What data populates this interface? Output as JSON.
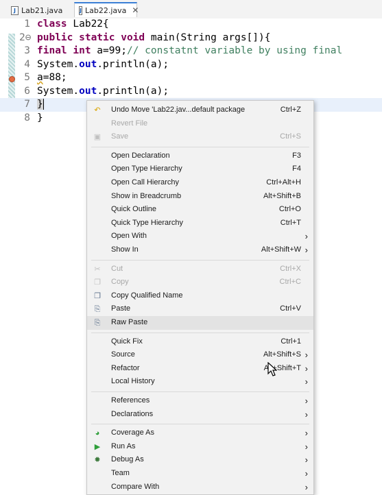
{
  "tabs": [
    {
      "label": "Lab21.java",
      "active": false
    },
    {
      "label": "Lab22.java",
      "active": true
    }
  ],
  "editor": {
    "lines": [
      {
        "num": "1",
        "parts": [
          [
            "kw",
            "class"
          ],
          [
            "t",
            " Lab22{"
          ]
        ]
      },
      {
        "num": "2⊖",
        "parts": [
          [
            "kw",
            "public static void"
          ],
          [
            "t",
            " main(String args[]){"
          ]
        ]
      },
      {
        "num": "3",
        "parts": [
          [
            "kw",
            "final int"
          ],
          [
            "t",
            " a=99;"
          ],
          [
            "cmt",
            "// constatnt variable by using final"
          ]
        ]
      },
      {
        "num": "4",
        "parts": [
          [
            "t",
            "System."
          ],
          [
            "field",
            "out"
          ],
          [
            "t",
            ".println(a);"
          ]
        ]
      },
      {
        "num": "5",
        "parts": [
          [
            "sq",
            "a"
          ],
          [
            "t",
            "=88;"
          ]
        ]
      },
      {
        "num": "6",
        "parts": [
          [
            "t",
            "System."
          ],
          [
            "field",
            "out"
          ],
          [
            "t",
            ".println(a);"
          ]
        ]
      },
      {
        "num": "7",
        "parts": [
          [
            "hl",
            "}"
          ],
          [
            "caret",
            ""
          ]
        ]
      },
      {
        "num": "8",
        "parts": [
          [
            "t",
            "}"
          ]
        ]
      }
    ]
  },
  "menu": {
    "items": [
      {
        "label": "Undo Move 'Lab22.jav...default package",
        "shortcut": "Ctrl+Z",
        "icon": "undo-icon",
        "glyph": "↶",
        "enabled": true
      },
      {
        "label": "Revert File",
        "shortcut": "",
        "enabled": false
      },
      {
        "label": "Save",
        "shortcut": "Ctrl+S",
        "icon": "save-icon",
        "glyph": "▣",
        "enabled": false
      },
      {
        "sep": true
      },
      {
        "label": "Open Declaration",
        "shortcut": "F3",
        "enabled": true
      },
      {
        "label": "Open Type Hierarchy",
        "shortcut": "F4",
        "enabled": true
      },
      {
        "label": "Open Call Hierarchy",
        "shortcut": "Ctrl+Alt+H",
        "enabled": true
      },
      {
        "label": "Show in Breadcrumb",
        "shortcut": "Alt+Shift+B",
        "enabled": true
      },
      {
        "label": "Quick Outline",
        "shortcut": "Ctrl+O",
        "enabled": true
      },
      {
        "label": "Quick Type Hierarchy",
        "shortcut": "Ctrl+T",
        "enabled": true
      },
      {
        "label": "Open With",
        "shortcut": "",
        "submenu": true,
        "enabled": true
      },
      {
        "label": "Show In",
        "shortcut": "Alt+Shift+W",
        "submenu": true,
        "enabled": true
      },
      {
        "sep": true
      },
      {
        "label": "Cut",
        "shortcut": "Ctrl+X",
        "icon": "scissors-icon",
        "glyph": "✂",
        "enabled": false
      },
      {
        "label": "Copy",
        "shortcut": "Ctrl+C",
        "icon": "copy-icon",
        "glyph": "❐",
        "enabled": false
      },
      {
        "label": "Copy Qualified Name",
        "shortcut": "",
        "icon": "copy-qualified-icon",
        "glyph": "❐",
        "enabled": true
      },
      {
        "label": "Paste",
        "shortcut": "Ctrl+V",
        "icon": "paste-icon",
        "glyph": "⎘",
        "enabled": true
      },
      {
        "label": "Raw Paste",
        "shortcut": "",
        "icon": "raw-paste-icon",
        "glyph": "⎘",
        "enabled": true,
        "hover": true
      },
      {
        "sep": true
      },
      {
        "label": "Quick Fix",
        "shortcut": "Ctrl+1",
        "enabled": true
      },
      {
        "label": "Source",
        "shortcut": "Alt+Shift+S",
        "submenu": true,
        "enabled": true
      },
      {
        "label": "Refactor",
        "shortcut": "Alt+Shift+T",
        "submenu": true,
        "enabled": true
      },
      {
        "label": "Local History",
        "shortcut": "",
        "submenu": true,
        "enabled": true
      },
      {
        "sep": true
      },
      {
        "label": "References",
        "shortcut": "",
        "submenu": true,
        "enabled": true
      },
      {
        "label": "Declarations",
        "shortcut": "",
        "submenu": true,
        "enabled": true
      },
      {
        "sep": true
      },
      {
        "label": "Coverage As",
        "shortcut": "",
        "icon": "coverage-icon",
        "glyph": "◕",
        "submenu": true,
        "enabled": true
      },
      {
        "label": "Run As",
        "shortcut": "",
        "icon": "run-icon",
        "glyph": "▶",
        "submenu": true,
        "enabled": true
      },
      {
        "label": "Debug As",
        "shortcut": "",
        "icon": "bug-icon",
        "glyph": "✹",
        "submenu": true,
        "enabled": true
      },
      {
        "label": "Team",
        "shortcut": "",
        "submenu": true,
        "enabled": true
      },
      {
        "label": "Compare With",
        "shortcut": "",
        "submenu": true,
        "enabled": true
      }
    ]
  },
  "colors": {
    "keyword": "#7f0055",
    "field": "#0000c0",
    "comment": "#3f7f5f",
    "run": "#2e9e3a",
    "coverage": "#2e9e3a",
    "bug": "#3c7a3c",
    "undo": "#d9a400"
  }
}
